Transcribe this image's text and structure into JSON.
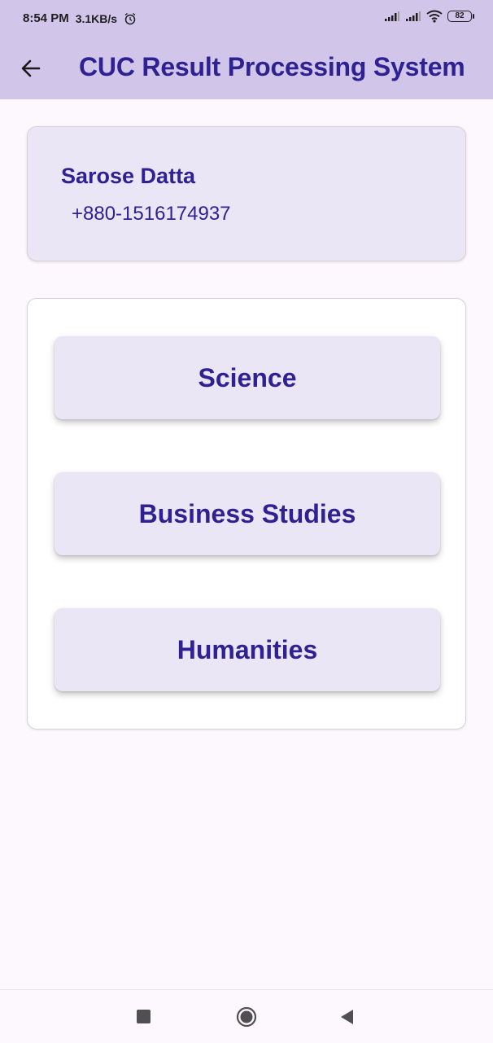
{
  "status_bar": {
    "time": "8:54 PM",
    "speed": "3.1KB/s",
    "battery": "82",
    "icons": [
      "alarm-icon",
      "signal-icon",
      "signal-icon",
      "wifi-icon",
      "battery-icon"
    ]
  },
  "app_bar": {
    "title": "CUC Result Processing System",
    "back_icon": "arrow-left-icon"
  },
  "profile": {
    "name": "Sarose Datta",
    "phone": "+880-1516174937"
  },
  "departments": [
    {
      "label": "Science"
    },
    {
      "label": "Business Studies"
    },
    {
      "label": "Humanities"
    }
  ],
  "nav_bar": {
    "icons": [
      "recent-apps-icon",
      "home-icon",
      "back-triangle-icon"
    ]
  },
  "colors": {
    "header_bg": "#d1c6ea",
    "accent_text": "#2f2191",
    "card_bg": "#ebe6f5",
    "page_bg": "#fdf8fd"
  }
}
